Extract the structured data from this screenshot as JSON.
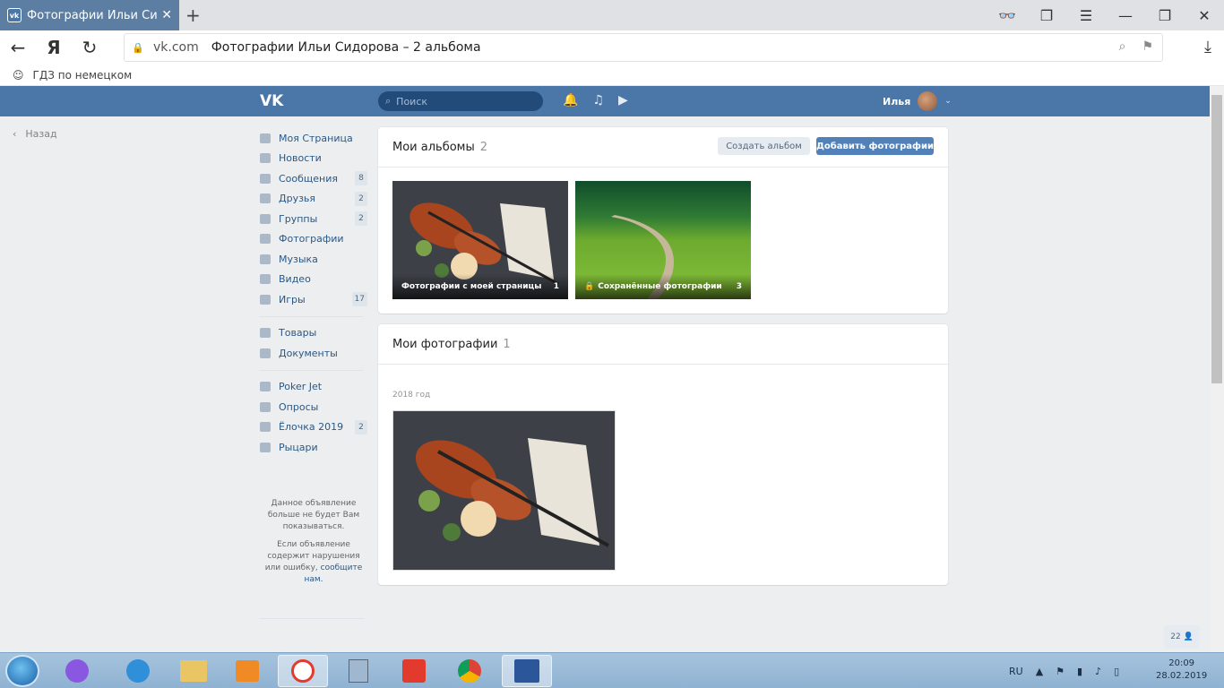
{
  "browser": {
    "tab_title": "Фотографии Ильи Сидо",
    "domain": "vk.com",
    "page_title": "Фотографии Ильи Сидорова – 2 альбома",
    "bookmark": "ГДЗ по немецком"
  },
  "header": {
    "search_placeholder": "Поиск",
    "user_name": "Илья"
  },
  "back_label": "Назад",
  "menu": {
    "my_page": "Моя Страница",
    "news": "Новости",
    "messages": "Сообщения",
    "messages_count": "8",
    "friends": "Друзья",
    "friends_count": "2",
    "groups": "Группы",
    "groups_count": "2",
    "photos": "Фотографии",
    "music": "Музыка",
    "video": "Видео",
    "games": "Игры",
    "games_count": "17",
    "goods": "Товары",
    "documents": "Документы",
    "poker": "Poker Jet",
    "polls": "Опросы",
    "tree": "Ёлочка 2019",
    "tree_count": "2",
    "knights": "Рыцари"
  },
  "ad": {
    "line1": "Данное объявление больше не будет Вам показываться.",
    "line2": "Если объявление содержит нарушения или ошибку,",
    "link": "сообщите нам."
  },
  "albums": {
    "title": "Мои альбомы",
    "count": "2",
    "create_btn": "Создать альбом",
    "add_btn": "Добавить фотографии",
    "items": [
      {
        "name": "Фотографии с моей страницы",
        "count": "1"
      },
      {
        "name": "Сохранённые фотографии",
        "count": "3"
      }
    ]
  },
  "photos": {
    "title": "Мои фотографии",
    "count": "1",
    "year": "2018 год"
  },
  "badge": "22",
  "taskbar": {
    "lang": "RU",
    "time": "20:09",
    "date": "28.02.2019"
  }
}
